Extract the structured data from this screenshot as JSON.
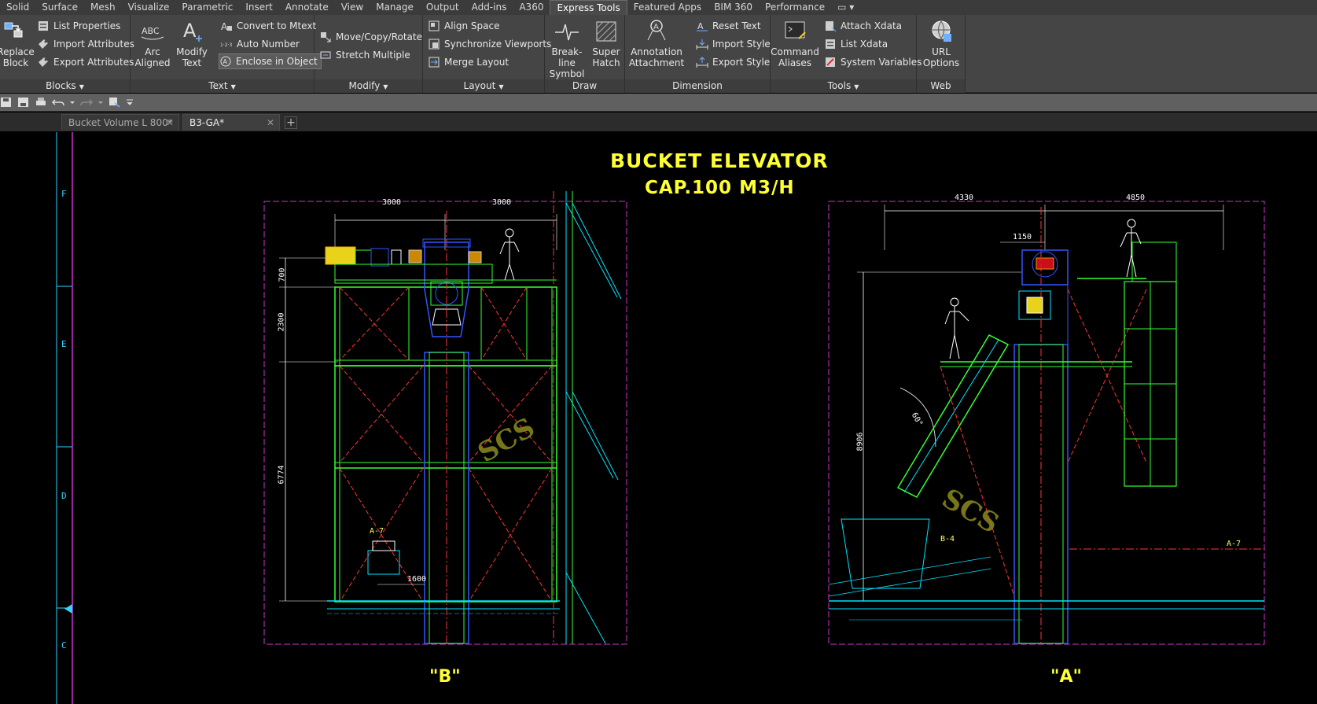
{
  "menu_tabs": [
    "Solid",
    "Surface",
    "Mesh",
    "Visualize",
    "Parametric",
    "Insert",
    "Annotate",
    "View",
    "Manage",
    "Output",
    "Add-ins",
    "A360",
    "Express Tools",
    "Featured Apps",
    "BIM 360",
    "Performance"
  ],
  "active_menu_tab": "Express Tools",
  "ribbon": {
    "blocks": {
      "title": "Blocks",
      "replace_block": "Replace\nBlock",
      "replace_block_l1": "Replace",
      "replace_block_l2": "Block",
      "list_properties": "List Properties",
      "import_attributes": "Import Attributes",
      "export_attributes": "Export Attributes"
    },
    "text": {
      "title": "Text",
      "arc_aligned_l1": "Arc",
      "arc_aligned_l2": "Aligned",
      "modify_text_l1": "Modify",
      "modify_text_l2": "Text",
      "convert_to_mtext": "Convert to Mtext",
      "auto_number": "Auto Number",
      "enclose_in_object": "Enclose in Object"
    },
    "modify": {
      "title": "Modify",
      "move_copy_rotate": "Move/Copy/Rotate",
      "stretch_multiple": "Stretch Multiple"
    },
    "layout": {
      "title": "Layout",
      "align_space": "Align Space",
      "synchronize_viewports": "Synchronize Viewports",
      "merge_layout": "Merge Layout"
    },
    "draw": {
      "title": "Draw",
      "break_line_l1": "Break-line",
      "break_line_l2": "Symbol",
      "super_hatch_l1": "Super",
      "super_hatch_l2": "Hatch"
    },
    "dimension": {
      "title": "Dimension",
      "annotation_attachment_l1": "Annotation",
      "annotation_attachment_l2": "Attachment",
      "reset_text": "Reset Text",
      "import_style": "Import Style",
      "export_style": "Export Style"
    },
    "tools": {
      "title": "Tools",
      "command_aliases_l1": "Command",
      "command_aliases_l2": "Aliases",
      "attach_xdata": "Attach Xdata",
      "list_xdata": "List Xdata",
      "system_variables": "System Variables"
    },
    "web": {
      "title": "Web",
      "url_options_l1": "URL",
      "url_options_l2": "Options"
    }
  },
  "file_tabs": [
    {
      "label": "Bucket Volume L 800*"
    },
    {
      "label": "B3-GA*"
    }
  ],
  "drawing": {
    "title_line1": "BUCKET ELEVATOR",
    "title_line2": "CAP.100 M3/H",
    "view_b_label": "\"B\"",
    "view_a_label": "\"A\"",
    "watermark": "SCS",
    "zone_letters": [
      "F",
      "E",
      "D",
      "C"
    ],
    "dims_b": {
      "top_left": "3000",
      "top_right": "3000",
      "v1": "700",
      "v2": "2300",
      "v3": "6774",
      "bottom": "1600",
      "tag": "A-7"
    },
    "dims_a": {
      "top_left": "4330",
      "top_right": "4850",
      "inner": "1150",
      "vertical": "8906",
      "angle": "60°",
      "tag_b4": "B-4",
      "tag_a7": "A-7"
    }
  },
  "colors": {
    "structure": "#33ff33",
    "centerline": "#ff3333",
    "cyan": "#00e5ff",
    "blue": "#3355ff",
    "border": "#cc33cc",
    "title": "#ffff33"
  }
}
